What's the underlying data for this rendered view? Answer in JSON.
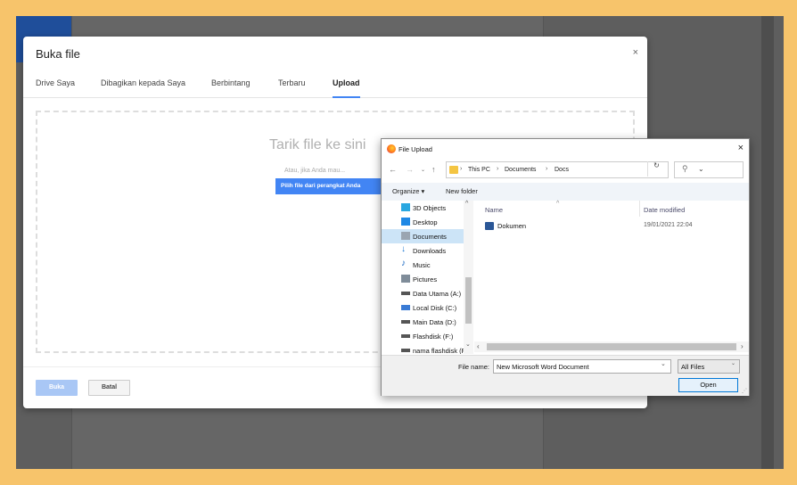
{
  "picker": {
    "title": "Buka file",
    "close_glyph": "×",
    "tabs": [
      "Drive Saya",
      "Dibagikan kepada Saya",
      "Berbintang",
      "Terbaru",
      "Upload"
    ],
    "active_tab": "Upload",
    "drop_title": "Tarik file ke sini",
    "drop_subtitle": "Atau, jika Anda mau...",
    "select_button": "Pilih file dari perangkat Anda",
    "open_button": "Buka",
    "cancel_button": "Batal"
  },
  "dialog": {
    "title": "File Upload",
    "close_glyph": "×",
    "breadcrumbs": [
      "This PC",
      "Documents",
      "Docs"
    ],
    "organize": "Organize ▾",
    "new_folder": "New folder",
    "nav_items": [
      {
        "label": "3D Objects",
        "icon": "cube-icon",
        "color": "#2aa7e0"
      },
      {
        "label": "Desktop",
        "icon": "desktop-icon",
        "color": "#1e88e5"
      },
      {
        "label": "Documents",
        "icon": "document-icon",
        "color": "#9aa5b1",
        "selected": true
      },
      {
        "label": "Downloads",
        "icon": "download-icon",
        "color": "#1976d2"
      },
      {
        "label": "Music",
        "icon": "music-icon",
        "color": "#1565c0"
      },
      {
        "label": "Pictures",
        "icon": "pictures-icon",
        "color": "#7f8c99"
      },
      {
        "label": "Data Utama (A:)",
        "icon": "drive-icon",
        "color": "#555555"
      },
      {
        "label": "Local Disk (C:)",
        "icon": "windows-drive-icon",
        "color": "#3a7bd5"
      },
      {
        "label": "Main Data (D:)",
        "icon": "drive-icon",
        "color": "#555555"
      },
      {
        "label": "Flashdisk (F:)",
        "icon": "drive-icon",
        "color": "#555555"
      },
      {
        "label": "nama flashdisk (F:)",
        "icon": "drive-icon",
        "color": "#555555"
      }
    ],
    "columns": {
      "name": "Name",
      "date": "Date modified"
    },
    "files": [
      {
        "name": "Dokumen",
        "date": "19/01/2021 22:04",
        "icon": "word-doc-icon"
      }
    ],
    "file_name_label": "File name:",
    "file_name_value": "New Microsoft Word Document",
    "file_type": "All Files",
    "open_button": "Open"
  }
}
